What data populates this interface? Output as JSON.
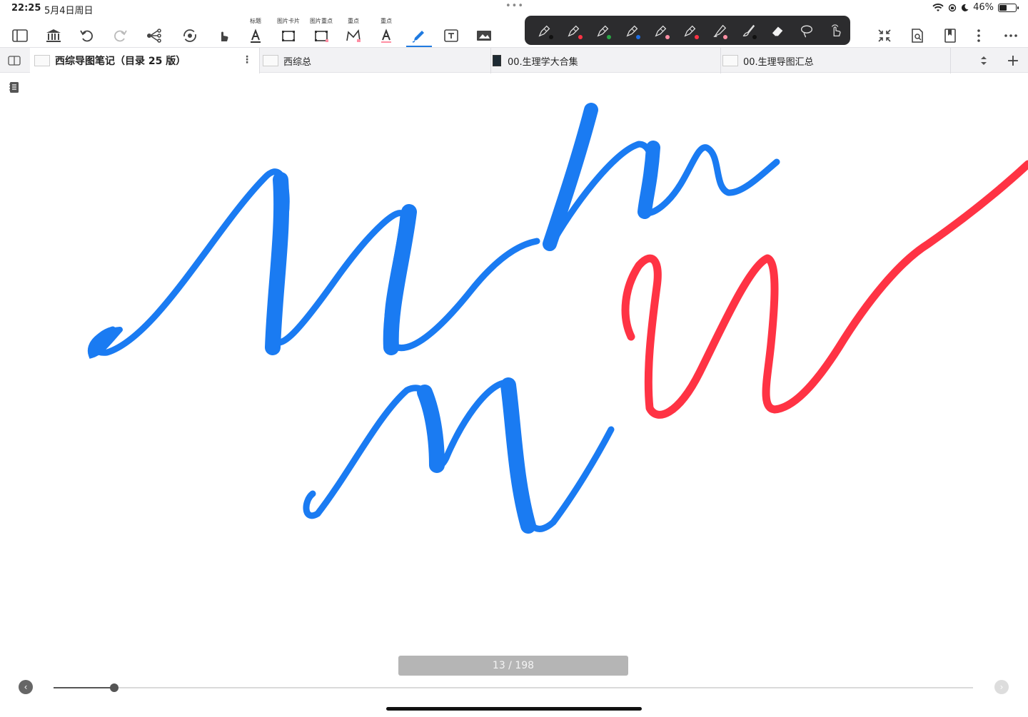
{
  "status_bar": {
    "time": "22:25",
    "date": "5月4日周日",
    "multitask_dots": "•••",
    "battery_percent": "46%",
    "battery_level": 0.46
  },
  "toolbar": {
    "captions": {
      "title_tool": "标题",
      "image_card": "图片卡片",
      "image_highlight": "图片重点",
      "highlight_1": "重点",
      "highlight_2": "重点"
    },
    "left_icons": [
      "sidebar-toggle-icon",
      "library-icon",
      "undo-icon",
      "redo-icon",
      "mindmap-icon",
      "sync-icon",
      "hand-pointer-icon",
      "title-text-icon",
      "image-card-icon",
      "image-highlight-icon",
      "highlight-brush-icon",
      "highlight-text-icon",
      "pencil-icon",
      "textbox-icon",
      "image-icon"
    ],
    "active_tool": "pencil-icon",
    "pen_tray": [
      {
        "icon": "fountain-pen-icon",
        "color": "#111111"
      },
      {
        "icon": "fountain-pen-icon",
        "color": "#ff3344"
      },
      {
        "icon": "fountain-pen-icon",
        "color": "#28a745"
      },
      {
        "icon": "fountain-pen-icon",
        "color": "#1e6fe6"
      },
      {
        "icon": "fountain-pen-icon",
        "color": "#ff8fa3"
      },
      {
        "icon": "fountain-pen-icon",
        "color": "#ff3344"
      },
      {
        "icon": "highlighter-icon",
        "color": "#ff8fa3"
      },
      {
        "icon": "brush-icon",
        "color": "#111111"
      },
      {
        "icon": "eraser-icon",
        "color": ""
      },
      {
        "icon": "lasso-icon",
        "color": ""
      },
      {
        "icon": "touch-icon",
        "color": ""
      }
    ],
    "right_icons": [
      "collapse-icon",
      "search-document-icon",
      "bookmark-icon",
      "vertical-more-icon",
      "horizontal-more-icon"
    ]
  },
  "tabs": [
    {
      "label": "西综导图笔记（目录 25 版）",
      "active": true
    },
    {
      "label": "西综总",
      "active": false
    },
    {
      "label": "00.生理学大合集",
      "active": false
    },
    {
      "label": "00.生理导图汇总",
      "active": false
    }
  ],
  "pager": {
    "current": 13,
    "total": 198,
    "label": "13 / 198",
    "progress": 0.0657
  },
  "colors": {
    "ink_blue": "#1a7bf2",
    "ink_red": "#ff3344",
    "accent": "#1f7ae0"
  }
}
